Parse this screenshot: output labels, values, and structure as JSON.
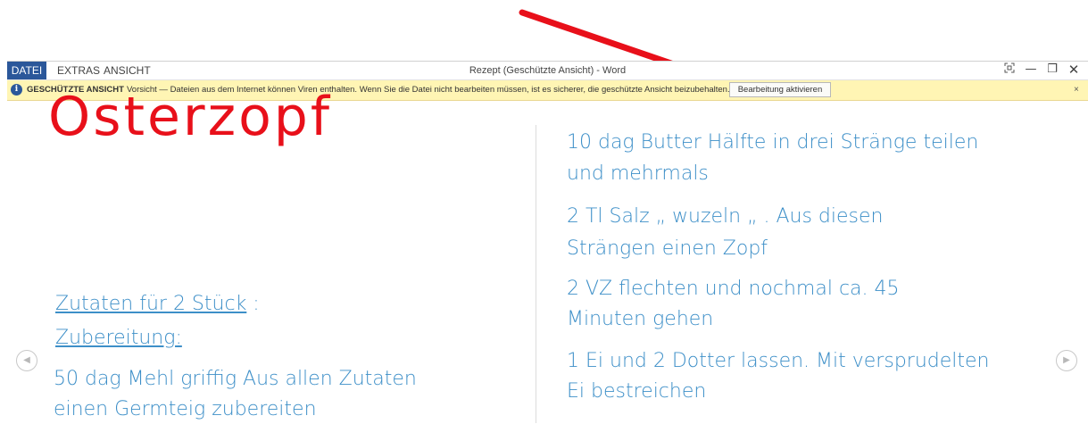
{
  "window": {
    "title": "Rezept (Geschützte Ansicht) - Word",
    "menu": [
      {
        "label": "DATEI"
      },
      {
        "label": "EXTRAS"
      },
      {
        "label": "ANSICHT"
      }
    ],
    "controls": {
      "focus_icon": "focus-mode-icon",
      "minimize": "—",
      "restore": "❐",
      "close": "✕"
    }
  },
  "message_bar": {
    "title": "GESCHÜTZTE ANSICHT",
    "text": "Vorsicht — Dateien aus dem Internet können Viren enthalten. Wenn Sie die Datei nicht bearbeiten müssen, ist es sicherer, die geschützte Ansicht beizubehalten.",
    "button_label": "Bearbeitung aktivieren",
    "close": "×",
    "icon": "info-icon"
  },
  "document": {
    "title": "Osterzopf",
    "ingredients_heading": "Zutaten für 2 Stück",
    "ingredients_heading_suffix": " :",
    "preparation_heading": "Zubereitung:",
    "left_lines": [
      "50 dag Mehl griffig   Aus allen Zutaten",
      "einen Germteig zubereiten"
    ],
    "right_lines": [
      "10 dag Butter   Hälfte in drei Stränge teilen",
      "und mehrmals",
      "2 Tl Salz           „ wuzeln „ . Aus diesen",
      "Strängen einen Zopf",
      "2 VZ                 flechten und nochmal ca. 45",
      "Minuten gehen",
      "1 Ei und 2 Dotter  lassen. Mit versprudelten",
      "Ei bestreichen"
    ]
  },
  "navigation": {
    "prev_icon": "chevron-left-icon",
    "next_icon": "chevron-right-icon",
    "prev_glyph": "◀",
    "next_glyph": "▶"
  },
  "colors": {
    "accent": "#2b579a",
    "title_red": "#e8101a",
    "text_blue": "#3d8fc8",
    "message_bar": "#fff5b4",
    "annotation_arrow": "#e8101a"
  }
}
